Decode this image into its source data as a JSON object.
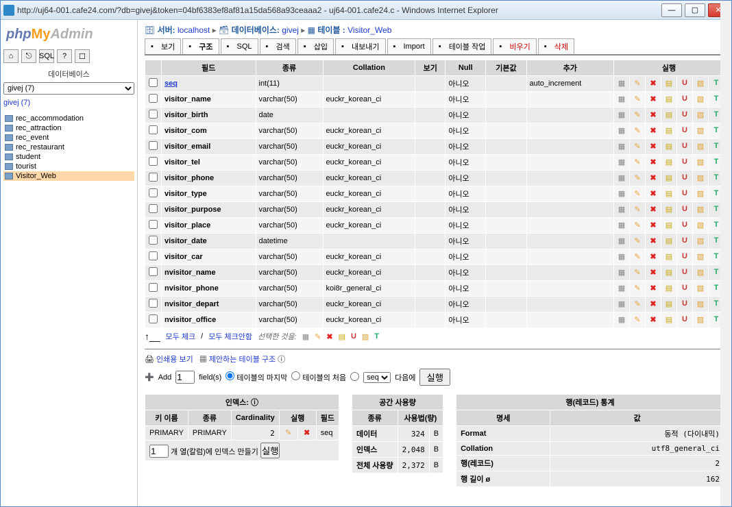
{
  "window": {
    "title": "http://uj64-001.cafe24.com/?db=givej&token=04bf6383ef8af81a15da568a93ceaaa2 - uj64-001.cafe24.c - Windows Internet Explorer",
    "min": "—",
    "max": "▢",
    "close": "✕"
  },
  "logo": {
    "php": "php",
    "my": "My",
    "admin": "Admin"
  },
  "left": {
    "label": "데이터베이스",
    "selected_db": "givej (7)",
    "db_link": "givej (7)",
    "tables": [
      "rec_accommodation",
      "rec_attraction",
      "rec_event",
      "rec_restaurant",
      "student",
      "tourist",
      "Visitor_Web"
    ],
    "active_table": "Visitor_Web"
  },
  "breadcrumb": {
    "server_lbl": "서버:",
    "server": "localhost",
    "db_lbl": "데이터베이스:",
    "db": "givej",
    "tbl_lbl": "테이블 :",
    "tbl": "Visitor_Web"
  },
  "tabs": [
    {
      "label": "보기"
    },
    {
      "label": "구조",
      "active": true
    },
    {
      "label": "SQL"
    },
    {
      "label": "검색"
    },
    {
      "label": "삽입"
    },
    {
      "label": "내보내기"
    },
    {
      "label": "Import"
    },
    {
      "label": "테이블 작업"
    },
    {
      "label": "비우기",
      "danger": true
    },
    {
      "label": "삭제",
      "danger": true
    }
  ],
  "struct": {
    "headers": {
      "field": "필드",
      "type": "종류",
      "collation": "Collation",
      "view": "보기",
      "null": "Null",
      "default": "기본값",
      "extra": "추가",
      "actions": "실행"
    },
    "rows": [
      {
        "field": "seq",
        "link": true,
        "type": "int(11)",
        "collation": "",
        "null": "아니오",
        "extra": "auto_increment"
      },
      {
        "field": "visitor_name",
        "type": "varchar(50)",
        "collation": "euckr_korean_ci",
        "null": "아니오",
        "extra": ""
      },
      {
        "field": "visitor_birth",
        "type": "date",
        "collation": "",
        "null": "아니오",
        "extra": ""
      },
      {
        "field": "visitor_com",
        "type": "varchar(50)",
        "collation": "euckr_korean_ci",
        "null": "아니오",
        "extra": ""
      },
      {
        "field": "visitor_email",
        "type": "varchar(50)",
        "collation": "euckr_korean_ci",
        "null": "아니오",
        "extra": ""
      },
      {
        "field": "visitor_tel",
        "type": "varchar(50)",
        "collation": "euckr_korean_ci",
        "null": "아니오",
        "extra": ""
      },
      {
        "field": "visitor_phone",
        "type": "varchar(50)",
        "collation": "euckr_korean_ci",
        "null": "아니오",
        "extra": ""
      },
      {
        "field": "visitor_type",
        "type": "varchar(50)",
        "collation": "euckr_korean_ci",
        "null": "아니오",
        "extra": ""
      },
      {
        "field": "visitor_purpose",
        "type": "varchar(50)",
        "collation": "euckr_korean_ci",
        "null": "아니오",
        "extra": ""
      },
      {
        "field": "visitor_place",
        "type": "varchar(50)",
        "collation": "euckr_korean_ci",
        "null": "아니오",
        "extra": ""
      },
      {
        "field": "visitor_date",
        "type": "datetime",
        "collation": "",
        "null": "아니오",
        "extra": ""
      },
      {
        "field": "visitor_car",
        "type": "varchar(50)",
        "collation": "euckr_korean_ci",
        "null": "아니오",
        "extra": ""
      },
      {
        "field": "nvisitor_name",
        "type": "varchar(50)",
        "collation": "euckr_korean_ci",
        "null": "아니오",
        "extra": ""
      },
      {
        "field": "nvisitor_phone",
        "type": "varchar(50)",
        "collation": "koi8r_general_ci",
        "null": "아니오",
        "extra": ""
      },
      {
        "field": "nvisitor_depart",
        "type": "varchar(50)",
        "collation": "euckr_korean_ci",
        "null": "아니오",
        "extra": ""
      },
      {
        "field": "nvisitor_office",
        "type": "varchar(50)",
        "collation": "euckr_korean_ci",
        "null": "아니오",
        "extra": ""
      }
    ]
  },
  "footer": {
    "check_all": "모두 체크",
    "uncheck_all": "모두 체크안함",
    "with_selected": "선택한 것을:"
  },
  "print": {
    "print_view": "인쇄용 보기",
    "propose": "제안하는 테이블 구조"
  },
  "add": {
    "prefix": "Add",
    "fieldcount": "1",
    "suffix": "field(s)",
    "opt_end": "테이블의 마지막",
    "opt_begin": "테이블의 처음",
    "select_value": "seq",
    "after": "다음에",
    "go": "실행"
  },
  "indexes": {
    "title": "인덱스:",
    "h_key": "키 이름",
    "h_type": "종류",
    "h_card": "Cardinality",
    "h_act": "실행",
    "h_field": "필드",
    "row": {
      "key": "PRIMARY",
      "type": "PRIMARY",
      "card": "2",
      "field": "seq"
    },
    "make": {
      "count": "1",
      "label": "개 열(칼럼)에 인덱스 만들기",
      "go": "실행"
    }
  },
  "space": {
    "title": "공간 사용량",
    "h_type": "종류",
    "h_usage": "사용법(량)",
    "rows": [
      {
        "label": "데이터",
        "val": "324",
        "unit": "B"
      },
      {
        "label": "인덱스",
        "val": "2,048",
        "unit": "B"
      },
      {
        "label": "전체 사용량",
        "val": "2,372",
        "unit": "B"
      }
    ]
  },
  "stats": {
    "title": "행(레코드) 통계",
    "h_name": "명세",
    "h_val": "값",
    "rows": [
      {
        "label": "Format",
        "val": "동적 (다이내믹)"
      },
      {
        "label": "Collation",
        "val": "utf8_general_ci"
      },
      {
        "label": "행(레코드)",
        "val": "2"
      },
      {
        "label": "행 길이 ø",
        "val": "162"
      }
    ]
  }
}
